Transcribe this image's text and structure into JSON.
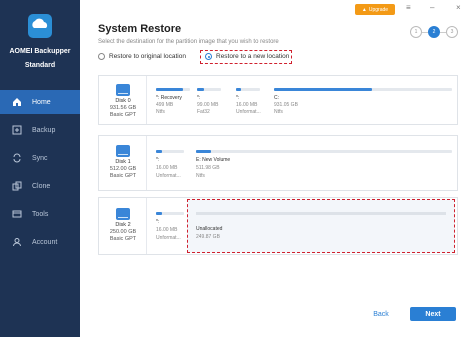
{
  "app": {
    "name_line1": "AOMEI Backupper",
    "name_line2": "Standard",
    "upgrade_label": "Upgrade"
  },
  "sidebar": {
    "items": [
      {
        "label": "Home",
        "icon": "home-icon",
        "active": true
      },
      {
        "label": "Backup",
        "icon": "backup-icon",
        "active": false
      },
      {
        "label": "Sync",
        "icon": "sync-icon",
        "active": false
      },
      {
        "label": "Clone",
        "icon": "clone-icon",
        "active": false
      },
      {
        "label": "Tools",
        "icon": "tools-icon",
        "active": false
      },
      {
        "label": "Account",
        "icon": "account-icon",
        "active": false
      }
    ]
  },
  "window_controls": {
    "menu": "≡",
    "minimize": "–",
    "close": "×"
  },
  "page": {
    "title": "System Restore",
    "subtitle": "Select the destination for the partition image that you wish to restore"
  },
  "steps": [
    "1",
    "2",
    "3"
  ],
  "restore_options": {
    "original": "Restore to original location",
    "new": "Restore to a new location"
  },
  "disks": [
    {
      "name": "Disk 0",
      "size": "931.56 GB",
      "type": "Basic GPT",
      "partitions": [
        {
          "label": "*: Recovery",
          "size": "499 MB",
          "fs": "Ntfs"
        },
        {
          "label": "*:",
          "size": "99.00 MB",
          "fs": "Fat32"
        },
        {
          "label": "*:",
          "size": "16.00 MB",
          "fs": "Unformat..."
        },
        {
          "label": "C:",
          "size": "931.05 GB",
          "fs": "Ntfs"
        }
      ]
    },
    {
      "name": "Disk 1",
      "size": "512.00 GB",
      "type": "Basic GPT",
      "partitions": [
        {
          "label": "*:",
          "size": "16.00 MB",
          "fs": "Unformat..."
        },
        {
          "label": "E: New Volume",
          "size": "511.98 GB",
          "fs": "Ntfs"
        }
      ]
    },
    {
      "name": "Disk 2",
      "size": "250.00 GB",
      "type": "Basic GPT",
      "partitions": [
        {
          "label": "*:",
          "size": "16.00 MB",
          "fs": "Unformat..."
        },
        {
          "label": "Unallocated",
          "size": "249.87 GB",
          "fs": ""
        }
      ]
    }
  ],
  "buttons": {
    "back": "Back",
    "next": "Next"
  },
  "colors": {
    "sidebar": "#1e3354",
    "accent": "#2a7fd4",
    "highlight": "#d0202e",
    "upgrade": "#f39a16"
  }
}
